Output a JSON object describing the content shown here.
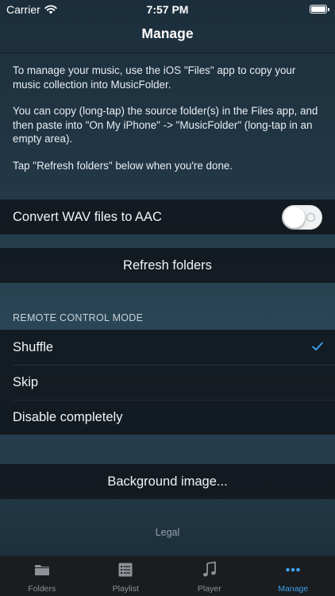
{
  "status": {
    "carrier": "Carrier",
    "time": "7:57 PM"
  },
  "nav": {
    "title": "Manage"
  },
  "info": {
    "paragraphs": [
      "To manage your music, use the iOS \"Files\" app to copy your music collection into MusicFolder.",
      "You can copy (long-tap) the source folder(s) in the Files app, and then paste into \"On My iPhone\" -> \"MusicFolder\" (long-tap in an empty area).",
      "Tap \"Refresh folders\" below when you're done."
    ]
  },
  "settings": {
    "convert_label": "Convert WAV files to AAC",
    "convert_enabled": false,
    "refresh_label": "Refresh folders"
  },
  "remote": {
    "header": "REMOTE CONTROL MODE",
    "options": [
      {
        "label": "Shuffle",
        "selected": true
      },
      {
        "label": "Skip",
        "selected": false
      },
      {
        "label": "Disable completely",
        "selected": false
      }
    ]
  },
  "background": {
    "label": "Background image..."
  },
  "legal": {
    "label": "Legal"
  },
  "tabs": [
    {
      "label": "Folders",
      "icon": "folder-icon",
      "active": false
    },
    {
      "label": "Playlist",
      "icon": "list-icon",
      "active": false
    },
    {
      "label": "Player",
      "icon": "music-note-icon",
      "active": false
    },
    {
      "label": "Manage",
      "icon": "more-dots-icon",
      "active": true
    }
  ],
  "colors": {
    "accent": "#3aa0ea",
    "row_bg": "#101418",
    "tab_inactive": "#8e9297"
  }
}
